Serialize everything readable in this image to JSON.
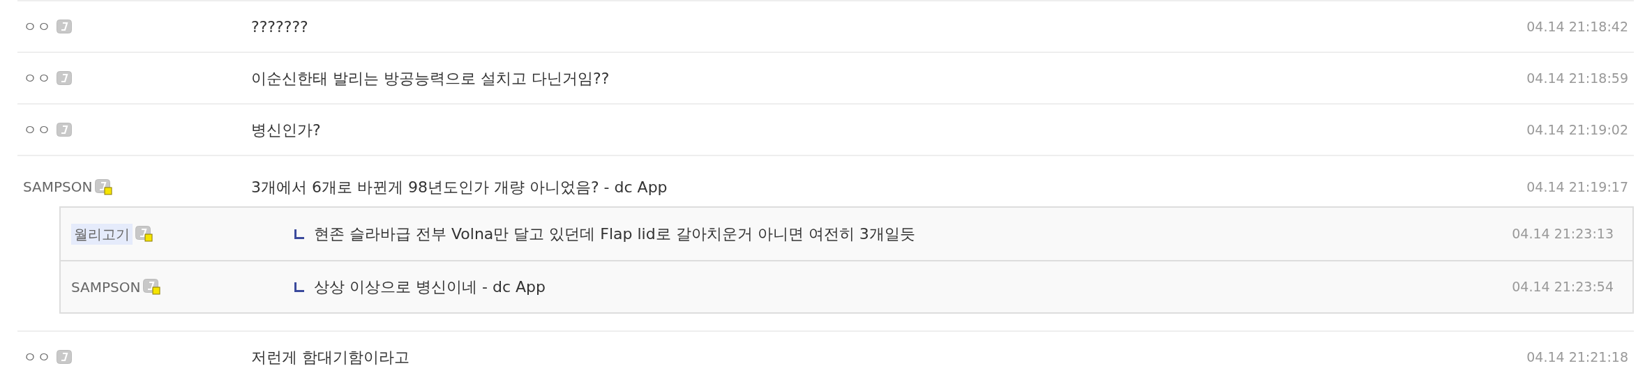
{
  "comments": [
    {
      "author": "ㅇㅇ",
      "kind": "guest",
      "text": "???????",
      "time": "04.14 21:18:42"
    },
    {
      "author": "ㅇㅇ",
      "kind": "guest",
      "text": "이순신한태 발리는 방공능력으로 설치고 다닌거임??",
      "time": "04.14 21:18:59"
    },
    {
      "author": "ㅇㅇ",
      "kind": "guest",
      "text": "병신인가?",
      "time": "04.14 21:19:02"
    },
    {
      "author": "SAMPSON",
      "kind": "member",
      "text": "3개에서 6개로 바뀐게 98년도인가 개량 아니었음? - dc App",
      "time": "04.14 21:19:17",
      "replies": [
        {
          "author": "월리고기",
          "kind": "member",
          "highlighted": true,
          "text": "현존 슬라바급 전부 Volna만 달고 있던데 Flap lid로 갈아치운거 아니면 여전히 3개일듯",
          "time": "04.14 21:23:13"
        },
        {
          "author": "SAMPSON",
          "kind": "member",
          "highlighted": false,
          "text": "상상 이상으로 병신이네 - dc App",
          "time": "04.14 21:23:54"
        }
      ]
    },
    {
      "author": "ㅇㅇ",
      "kind": "guest",
      "text": "저런게 함대기함이라고",
      "time": "04.14 21:21:18"
    }
  ]
}
